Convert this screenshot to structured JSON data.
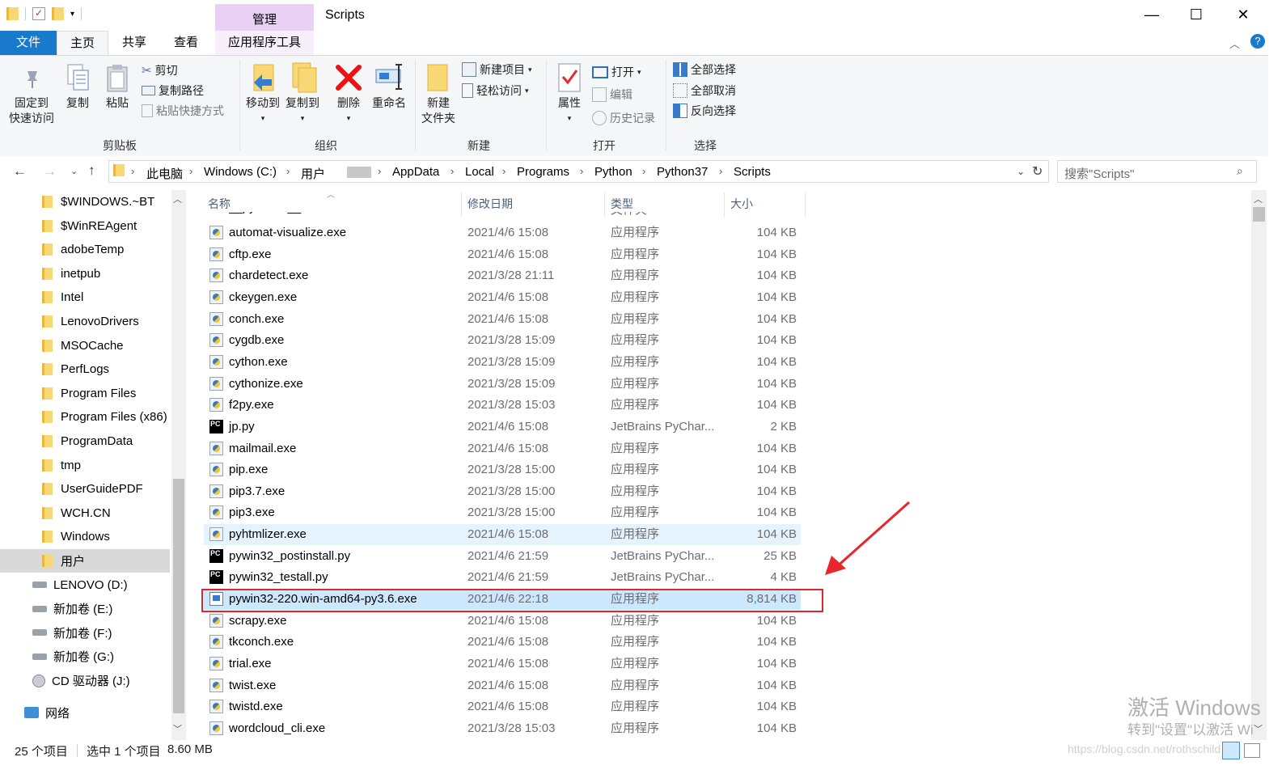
{
  "titlebar": {
    "manage_tab": "管理",
    "title": "Scripts",
    "minimize": "—",
    "maximize": "☐",
    "close": "✕"
  },
  "ribbon_tabs": {
    "file": "文件",
    "home": "主页",
    "share": "共享",
    "view": "查看",
    "app_tools": "应用程序工具"
  },
  "ribbon": {
    "clipboard": {
      "group": "剪贴板",
      "pin_line1": "固定到",
      "pin_line2": "快速访问",
      "copy": "复制",
      "paste": "粘贴",
      "cut": "剪切",
      "copy_path": "复制路径",
      "paste_shortcut": "粘贴快捷方式"
    },
    "organize": {
      "group": "组织",
      "move_to": "移动到",
      "copy_to": "复制到",
      "delete": "删除",
      "rename": "重命名"
    },
    "new": {
      "group": "新建",
      "new_folder_line1": "新建",
      "new_folder_line2": "文件夹",
      "new_item": "新建项目",
      "easy_access": "轻松访问"
    },
    "open": {
      "group": "打开",
      "properties": "属性",
      "open": "打开",
      "edit": "编辑",
      "history": "历史记录"
    },
    "select": {
      "group": "选择",
      "select_all": "全部选择",
      "select_none": "全部取消",
      "invert": "反向选择"
    }
  },
  "address": {
    "crumbs": [
      "此电脑",
      "Windows (C:)",
      "用户",
      "AppData",
      "Local",
      "Programs",
      "Python",
      "Python37",
      "Scripts"
    ],
    "search_placeholder": "搜索\"Scripts\""
  },
  "nav": {
    "items": [
      {
        "label": "$WINDOWS.~BT",
        "kind": "folder"
      },
      {
        "label": "$WinREAgent",
        "kind": "folder"
      },
      {
        "label": "adobeTemp",
        "kind": "folder"
      },
      {
        "label": "inetpub",
        "kind": "folder"
      },
      {
        "label": "Intel",
        "kind": "folder"
      },
      {
        "label": "LenovoDrivers",
        "kind": "folder"
      },
      {
        "label": "MSOCache",
        "kind": "folder"
      },
      {
        "label": "PerfLogs",
        "kind": "folder"
      },
      {
        "label": "Program Files",
        "kind": "folder"
      },
      {
        "label": "Program Files (x86)",
        "kind": "folder"
      },
      {
        "label": "ProgramData",
        "kind": "folder"
      },
      {
        "label": "tmp",
        "kind": "folder"
      },
      {
        "label": "UserGuidePDF",
        "kind": "folder"
      },
      {
        "label": "WCH.CN",
        "kind": "folder"
      },
      {
        "label": "Windows",
        "kind": "folder"
      },
      {
        "label": "用户",
        "kind": "folder",
        "selected": true
      },
      {
        "label": "LENOVO (D:)",
        "kind": "drive"
      },
      {
        "label": "新加卷 (E:)",
        "kind": "drive"
      },
      {
        "label": "新加卷 (F:)",
        "kind": "drive"
      },
      {
        "label": "新加卷 (G:)",
        "kind": "drive"
      },
      {
        "label": "CD 驱动器 (J:)",
        "kind": "cd"
      },
      {
        "label": "网络",
        "kind": "network"
      }
    ]
  },
  "columns": {
    "name": "名称",
    "date": "修改日期",
    "type": "类型",
    "size": "大小"
  },
  "files": [
    {
      "name": "automat-visualize.exe",
      "date": "2021/4/6 15:08",
      "type": "应用程序",
      "size": "104 KB",
      "icon": "python-exe-icon"
    },
    {
      "name": "cftp.exe",
      "date": "2021/4/6 15:08",
      "type": "应用程序",
      "size": "104 KB",
      "icon": "python-exe-icon"
    },
    {
      "name": "chardetect.exe",
      "date": "2021/3/28 21:11",
      "type": "应用程序",
      "size": "104 KB",
      "icon": "python-exe-icon"
    },
    {
      "name": "ckeygen.exe",
      "date": "2021/4/6 15:08",
      "type": "应用程序",
      "size": "104 KB",
      "icon": "python-exe-icon"
    },
    {
      "name": "conch.exe",
      "date": "2021/4/6 15:08",
      "type": "应用程序",
      "size": "104 KB",
      "icon": "python-exe-icon"
    },
    {
      "name": "cygdb.exe",
      "date": "2021/3/28 15:09",
      "type": "应用程序",
      "size": "104 KB",
      "icon": "python-exe-icon"
    },
    {
      "name": "cython.exe",
      "date": "2021/3/28 15:09",
      "type": "应用程序",
      "size": "104 KB",
      "icon": "python-exe-icon"
    },
    {
      "name": "cythonize.exe",
      "date": "2021/3/28 15:09",
      "type": "应用程序",
      "size": "104 KB",
      "icon": "python-exe-icon"
    },
    {
      "name": "f2py.exe",
      "date": "2021/3/28 15:03",
      "type": "应用程序",
      "size": "104 KB",
      "icon": "python-exe-icon"
    },
    {
      "name": "jp.py",
      "date": "2021/4/6 15:08",
      "type": "JetBrains PyChar...",
      "size": "2 KB",
      "icon": "pycharm-icon"
    },
    {
      "name": "mailmail.exe",
      "date": "2021/4/6 15:08",
      "type": "应用程序",
      "size": "104 KB",
      "icon": "python-exe-icon"
    },
    {
      "name": "pip.exe",
      "date": "2021/3/28 15:00",
      "type": "应用程序",
      "size": "104 KB",
      "icon": "python-exe-icon"
    },
    {
      "name": "pip3.7.exe",
      "date": "2021/3/28 15:00",
      "type": "应用程序",
      "size": "104 KB",
      "icon": "python-exe-icon"
    },
    {
      "name": "pip3.exe",
      "date": "2021/3/28 15:00",
      "type": "应用程序",
      "size": "104 KB",
      "icon": "python-exe-icon"
    },
    {
      "name": "pyhtmlizer.exe",
      "date": "2021/4/6 15:08",
      "type": "应用程序",
      "size": "104 KB",
      "icon": "python-exe-icon",
      "hover": true
    },
    {
      "name": "pywin32_postinstall.py",
      "date": "2021/4/6 21:59",
      "type": "JetBrains PyChar...",
      "size": "25 KB",
      "icon": "pycharm-icon"
    },
    {
      "name": "pywin32_testall.py",
      "date": "2021/4/6 21:59",
      "type": "JetBrains PyChar...",
      "size": "4 KB",
      "icon": "pycharm-icon"
    },
    {
      "name": "pywin32-220.win-amd64-py3.6.exe",
      "date": "2021/4/6 22:18",
      "type": "应用程序",
      "size": "8,814 KB",
      "icon": "installer-icon",
      "selected": true
    },
    {
      "name": "scrapy.exe",
      "date": "2021/4/6 15:08",
      "type": "应用程序",
      "size": "104 KB",
      "icon": "python-exe-icon"
    },
    {
      "name": "tkconch.exe",
      "date": "2021/4/6 15:08",
      "type": "应用程序",
      "size": "104 KB",
      "icon": "python-exe-icon"
    },
    {
      "name": "trial.exe",
      "date": "2021/4/6 15:08",
      "type": "应用程序",
      "size": "104 KB",
      "icon": "python-exe-icon"
    },
    {
      "name": "twist.exe",
      "date": "2021/4/6 15:08",
      "type": "应用程序",
      "size": "104 KB",
      "icon": "python-exe-icon"
    },
    {
      "name": "twistd.exe",
      "date": "2021/4/6 15:08",
      "type": "应用程序",
      "size": "104 KB",
      "icon": "python-exe-icon"
    },
    {
      "name": "wordcloud_cli.exe",
      "date": "2021/3/28 15:03",
      "type": "应用程序",
      "size": "104 KB",
      "icon": "python-exe-icon"
    }
  ],
  "status": {
    "count": "25 个项目",
    "selected": "选中 1 个项目",
    "size": "8.60 MB"
  },
  "watermark": {
    "line1": "激活 Windows",
    "line2": "转到\"设置\"以激活 Wi",
    "url": "https://blog.csdn.net/rothschild"
  },
  "colors": {
    "file_tab": "#1979ca",
    "manage_tab": "#e8d1f3",
    "selection_bg": "#cce8ff",
    "hover_bg": "#e5f3ff",
    "highlight_box": "#e0262c",
    "annotation_arrow": "#e8262c"
  }
}
